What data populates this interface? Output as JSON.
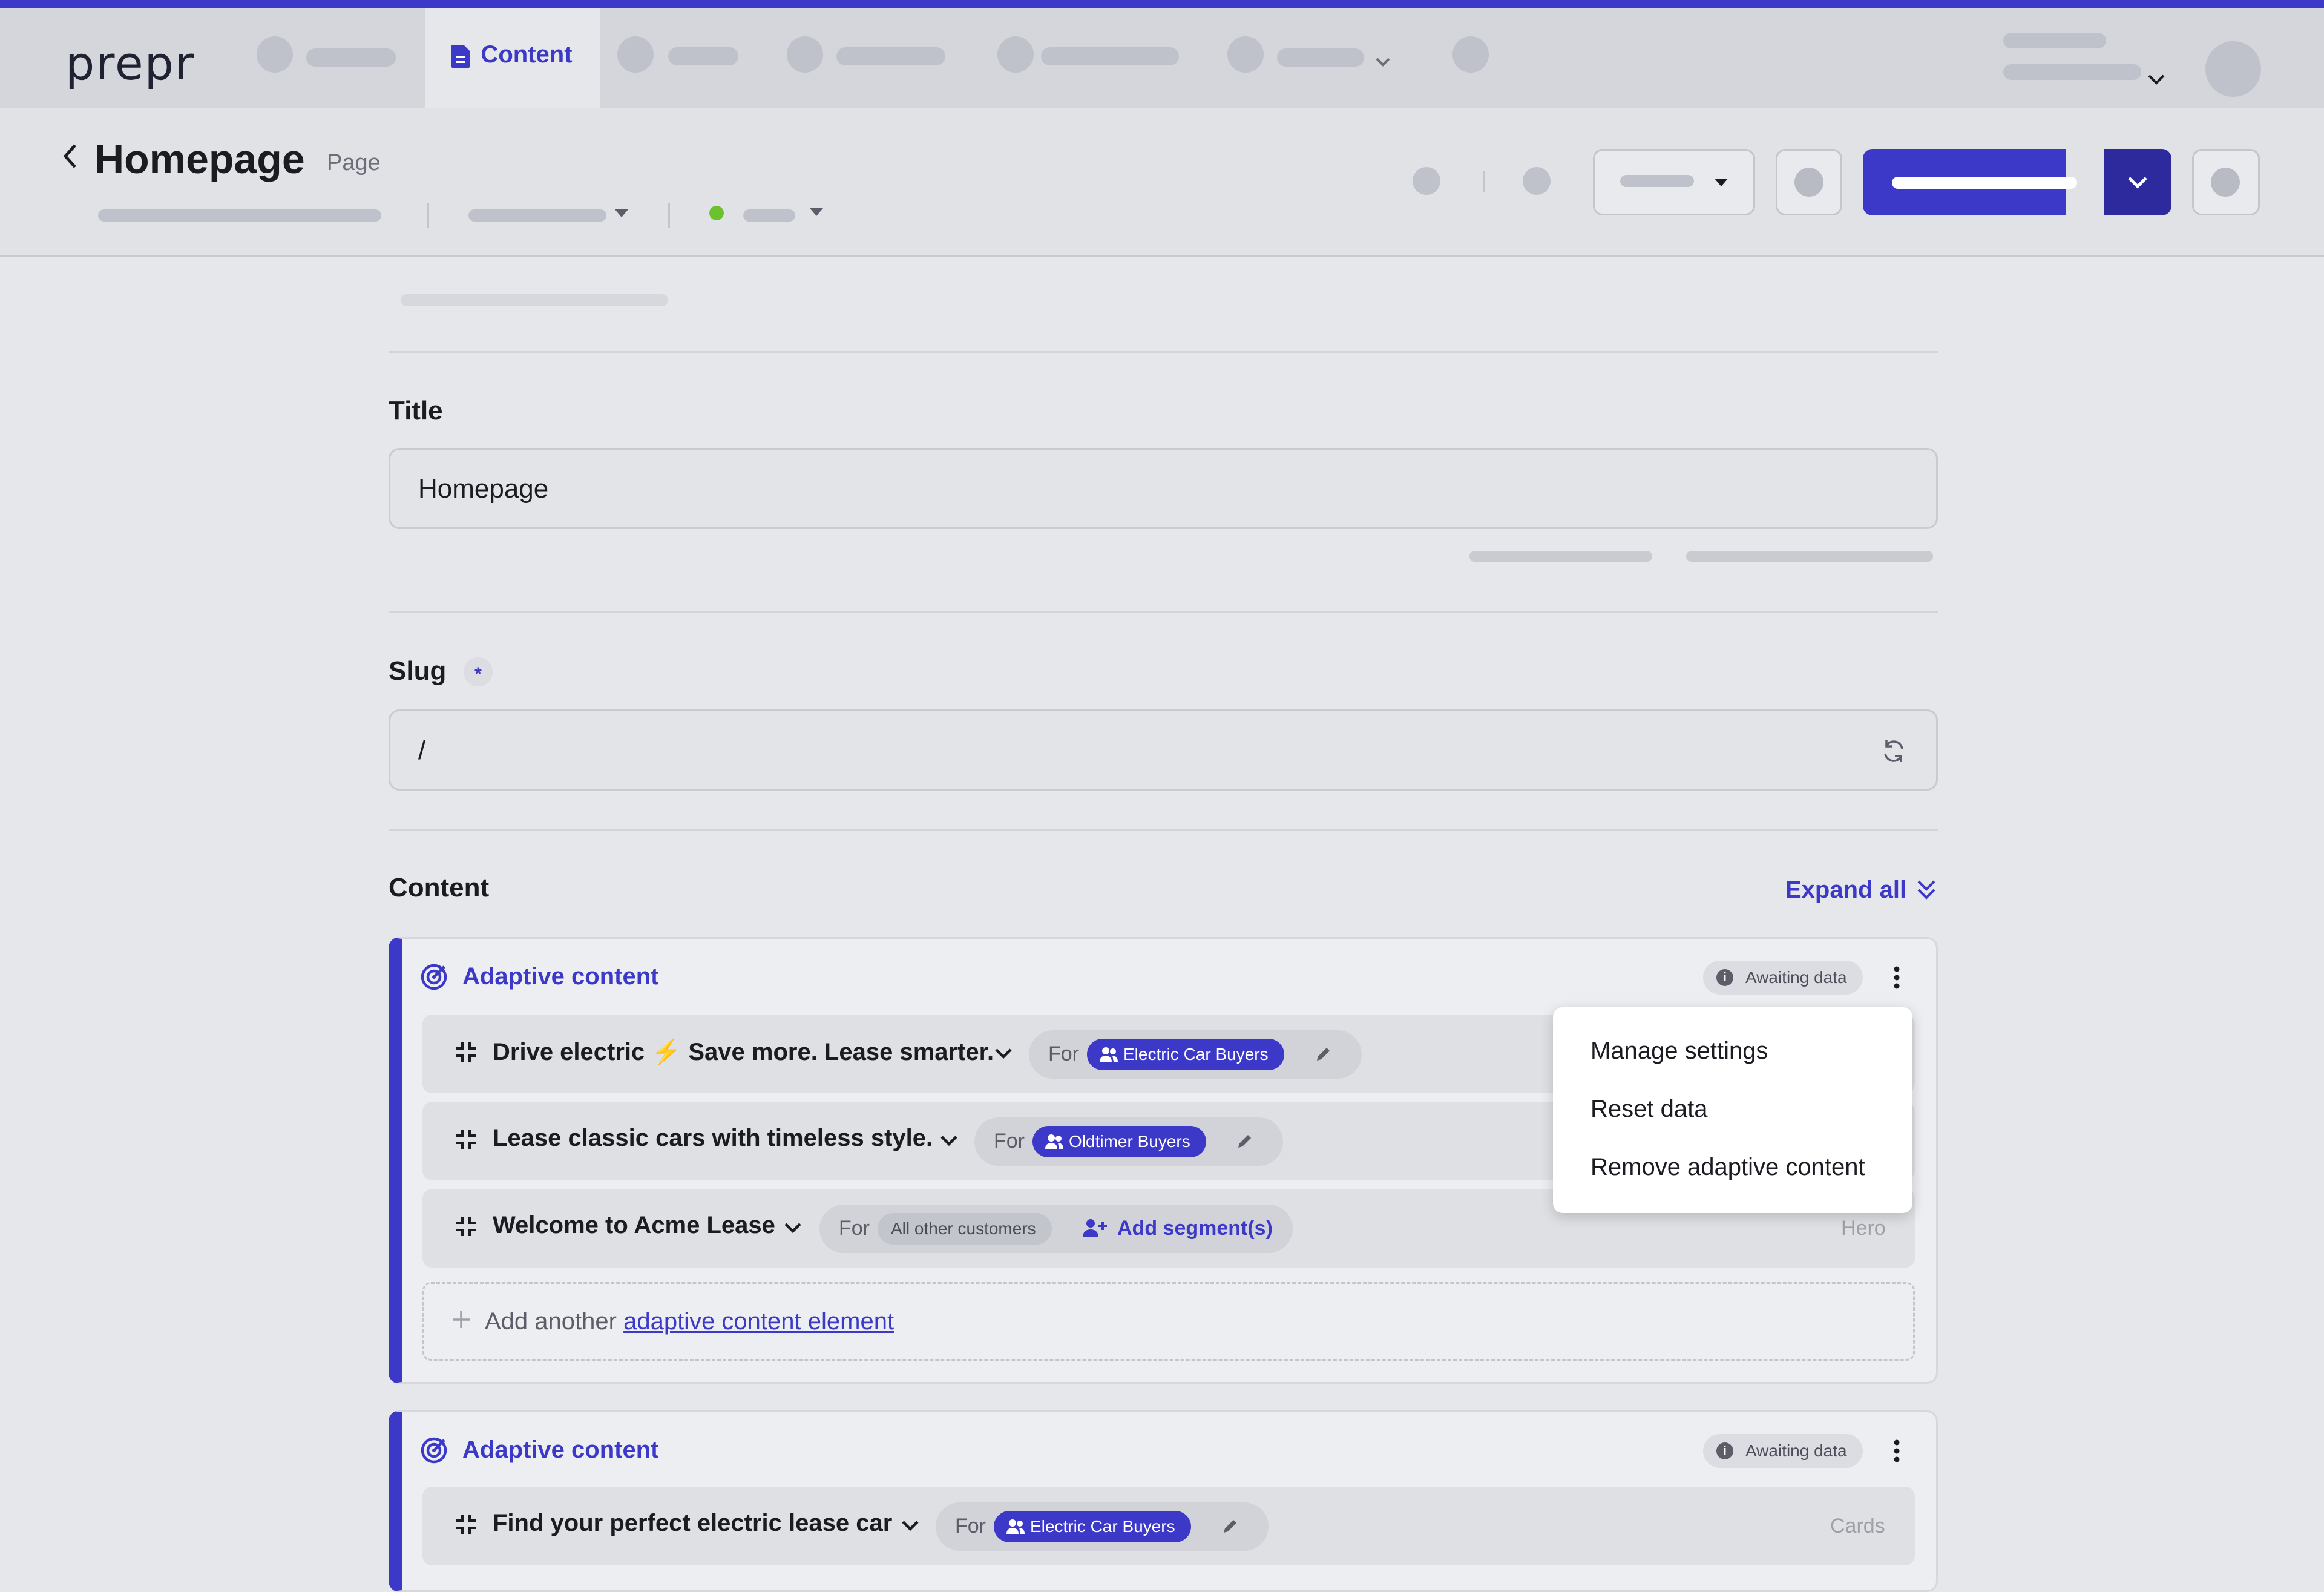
{
  "topbar": {
    "logo": "prepr",
    "active_tab": "Content",
    "accent": "#3c38c8"
  },
  "page": {
    "title": "Homepage",
    "type": "Page"
  },
  "form": {
    "title_label": "Title",
    "title_value": "Homepage",
    "slug_label": "Slug",
    "slug_required": "*",
    "slug_value": "/",
    "content_label": "Content",
    "expand_all": "Expand all"
  },
  "adaptive_blocks": [
    {
      "title": "Adaptive content",
      "status": "Awaiting data",
      "rows": [
        {
          "text": "Drive electric",
          "emoji": "⚡",
          "text2": "Save more. Lease smarter.",
          "for": "For",
          "segment": "Electric Car Buyers"
        },
        {
          "text": "Lease classic cars with timeless style.",
          "for": "For",
          "segment": "Oldtimer Buyers"
        },
        {
          "text": "Welcome to Acme Lease",
          "for": "For",
          "segment": "All other customers",
          "add_segment": "Add segment(s)",
          "type_label": "Hero"
        }
      ],
      "add_another_prefix": "Add another",
      "add_another_link": "adaptive content element"
    },
    {
      "title": "Adaptive content",
      "status": "Awaiting data",
      "rows": [
        {
          "text": "Find your perfect electric lease car",
          "for": "For",
          "segment": "Electric Car Buyers",
          "type_label": "Cards"
        }
      ]
    }
  ],
  "context_menu": {
    "items": [
      "Manage settings",
      "Reset data",
      "Remove adaptive content"
    ]
  }
}
